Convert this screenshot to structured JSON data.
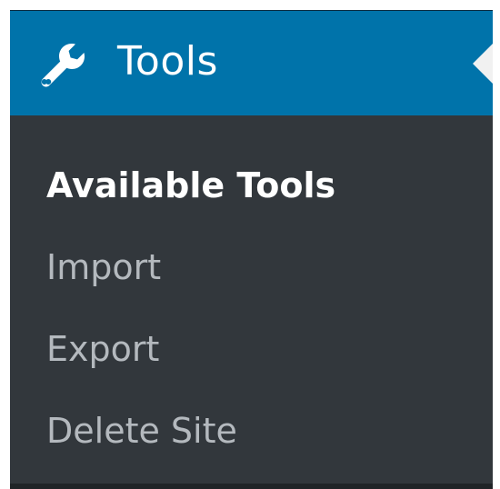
{
  "menu": {
    "header": {
      "title": "Tools",
      "icon": "wrench-icon",
      "background": "#0073aa",
      "text_color": "#ffffff"
    },
    "items": [
      {
        "label": "Available Tools",
        "current": true
      },
      {
        "label": "Import",
        "current": false
      },
      {
        "label": "Export",
        "current": false
      },
      {
        "label": "Delete Site",
        "current": false
      }
    ],
    "colors": {
      "menu_background": "#32373c",
      "item_text": "#b4b9be",
      "current_item_text": "#ffffff"
    }
  }
}
